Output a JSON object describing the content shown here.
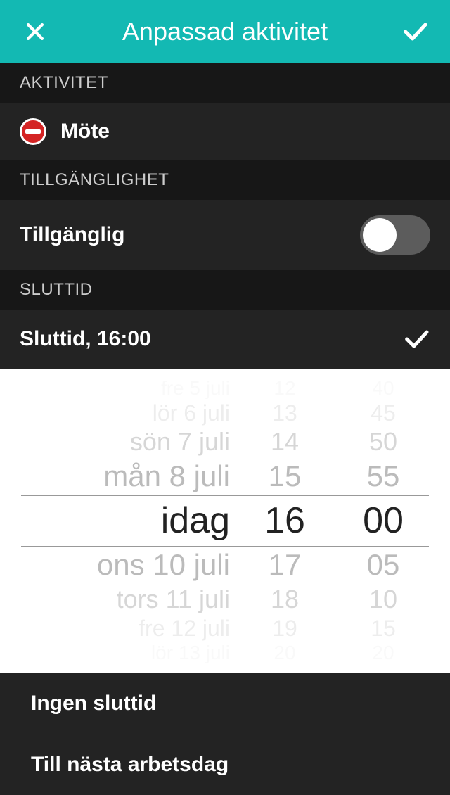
{
  "header": {
    "title": "Anpassad aktivitet"
  },
  "sections": {
    "activity": {
      "header": "AKTIVITET",
      "label": "Möte"
    },
    "availability": {
      "header": "TILLGÄNGLIGHET",
      "label": "Tillgänglig",
      "toggle_on": false
    },
    "endtime": {
      "header": "SLUTTID",
      "label": "Sluttid,  16:00"
    }
  },
  "picker": {
    "dates": {
      "minus4": "fre 5 juli",
      "minus3": "lör 6 juli",
      "minus2": "sön 7 juli",
      "minus1": "mån 8 juli",
      "selected": "idag",
      "plus1": "ons 10 juli",
      "plus2": "tors 11 juli",
      "plus3": "fre 12 juli",
      "plus4": "lör 13 juli"
    },
    "hours": {
      "minus4": "12",
      "minus3": "13",
      "minus2": "14",
      "minus1": "15",
      "selected": "16",
      "plus1": "17",
      "plus2": "18",
      "plus3": "19",
      "plus4": "20"
    },
    "minutes": {
      "minus4": "40",
      "minus3": "45",
      "minus2": "50",
      "minus1": "55",
      "selected": "00",
      "plus1": "05",
      "plus2": "10",
      "plus3": "15",
      "plus4": "20"
    }
  },
  "options": {
    "no_endtime": "Ingen sluttid",
    "next_workday": "Till nästa arbetsdag"
  }
}
